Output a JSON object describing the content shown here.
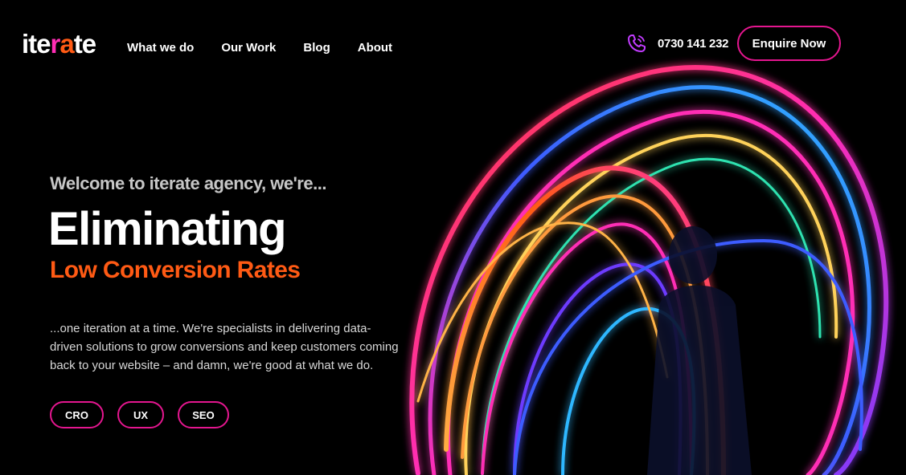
{
  "brand": {
    "logo_text": "iterate"
  },
  "nav": {
    "items": [
      {
        "label": "What we do"
      },
      {
        "label": "Our Work"
      },
      {
        "label": "Blog"
      },
      {
        "label": "About"
      }
    ]
  },
  "contact": {
    "phone_icon": "phone-icon",
    "phone_number": "0730 141 232"
  },
  "cta": {
    "enquire_label": "Enquire Now"
  },
  "hero": {
    "intro": "Welcome to iterate agency, we're...",
    "headline": "Eliminating",
    "subheadline": "Low Conversion Rates",
    "description": "...one iteration at a time. We're specialists in delivering data-driven solutions to grow conversions and keep customers coming back to your website – and damn, we're good at what we do.",
    "tags": [
      {
        "label": "CRO"
      },
      {
        "label": "UX"
      },
      {
        "label": "SEO"
      }
    ]
  },
  "colors": {
    "accent_orange": "#ff5a14",
    "accent_magenta": "#e4168f",
    "background": "#000000"
  }
}
